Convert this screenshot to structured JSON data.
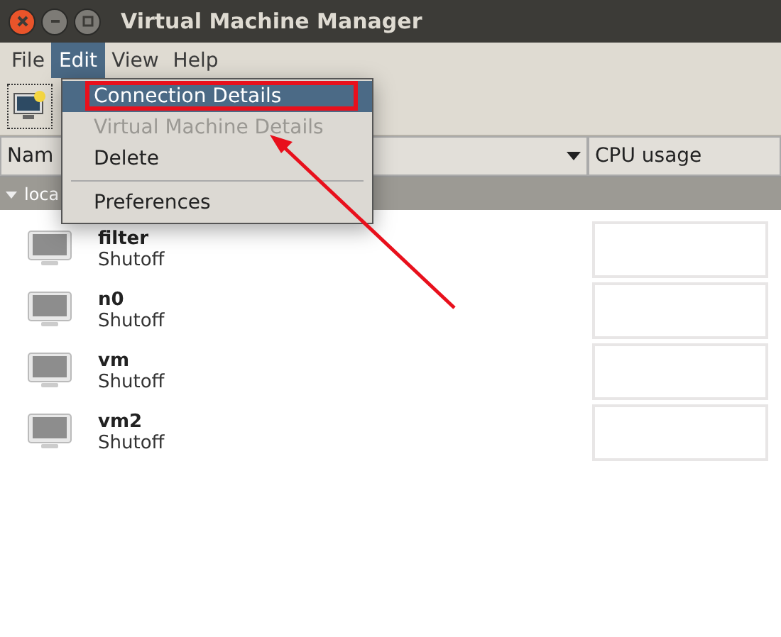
{
  "window": {
    "title": "Virtual Machine Manager"
  },
  "menubar": [
    {
      "label": "File",
      "selected": false
    },
    {
      "label": "Edit",
      "selected": true
    },
    {
      "label": "View",
      "selected": false
    },
    {
      "label": "Help",
      "selected": false
    }
  ],
  "menu": [
    {
      "kind": "item",
      "label": "Connection Details",
      "selected": true,
      "disabled": false,
      "highlighted": true
    },
    {
      "kind": "item",
      "label": "Virtual Machine Details",
      "selected": false,
      "disabled": true,
      "highlighted": false
    },
    {
      "kind": "item",
      "label": "Delete",
      "selected": false,
      "disabled": false,
      "highlighted": false
    },
    {
      "kind": "separator"
    },
    {
      "kind": "item",
      "label": "Preferences",
      "selected": false,
      "disabled": false,
      "highlighted": false
    }
  ],
  "columns": [
    {
      "label": "Nam"
    },
    {
      "label": "CPU usage"
    }
  ],
  "group": {
    "label": "loca",
    "expanded": true
  },
  "vms": [
    {
      "name": "filter",
      "status": "Shutoff"
    },
    {
      "name": "n0",
      "status": "Shutoff"
    },
    {
      "name": "vm",
      "status": "Shutoff"
    },
    {
      "name": "vm2",
      "status": "Shutoff"
    }
  ]
}
